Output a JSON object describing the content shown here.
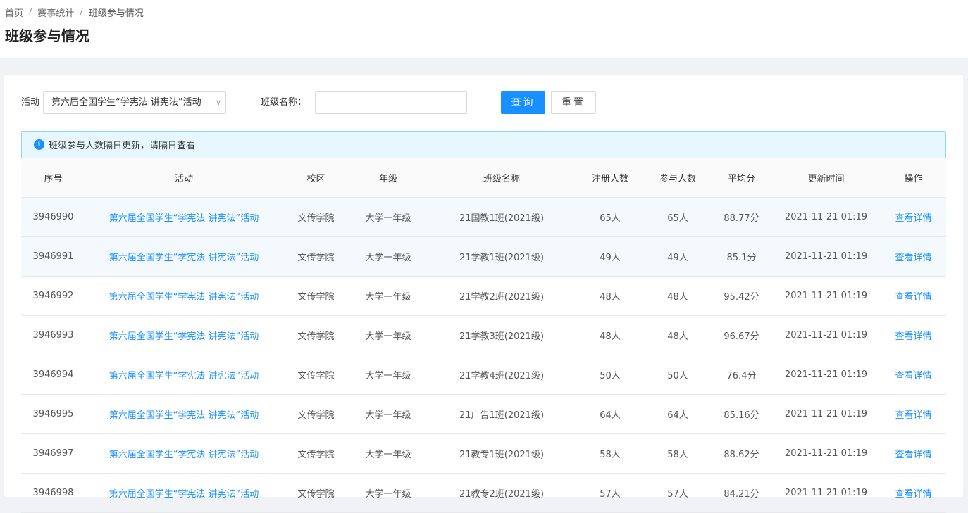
{
  "breadcrumb": [
    "首页",
    "赛事统计",
    "班级参与情况"
  ],
  "page_title": "班级参与情况",
  "filters": {
    "activity_label": "活动",
    "activity_value": "第六届全国学生“学宪法 讲宪法”活动",
    "class_name_label": "班级名称：",
    "class_name_value": "",
    "query_button": "查询",
    "reset_button": "重置"
  },
  "notice": "班级参与人数隔日更新，请隔日查看",
  "table": {
    "columns": [
      "序号",
      "活动",
      "校区",
      "年级",
      "班级名称",
      "注册人数",
      "参与人数",
      "平均分",
      "更新时间",
      "操作"
    ],
    "rows": [
      {
        "id": "3946990",
        "activity": "第六届全国学生“学宪法 讲宪法”活动",
        "campus": "文传学院",
        "grade": "大学一年级",
        "class_name": "21国教1班(2021级)",
        "registered": "65人",
        "participants": "65人",
        "avg": "88.77分",
        "updated": "2021-11-21 01:19",
        "action": "查看详情"
      },
      {
        "id": "3946991",
        "activity": "第六届全国学生“学宪法 讲宪法”活动",
        "campus": "文传学院",
        "grade": "大学一年级",
        "class_name": "21学教1班(2021级)",
        "registered": "49人",
        "participants": "49人",
        "avg": "85.1分",
        "updated": "2021-11-21 01:19",
        "action": "查看详情"
      },
      {
        "id": "3946992",
        "activity": "第六届全国学生“学宪法 讲宪法”活动",
        "campus": "文传学院",
        "grade": "大学一年级",
        "class_name": "21学教2班(2021级)",
        "registered": "48人",
        "participants": "48人",
        "avg": "95.42分",
        "updated": "2021-11-21 01:19",
        "action": "查看详情"
      },
      {
        "id": "3946993",
        "activity": "第六届全国学生“学宪法 讲宪法”活动",
        "campus": "文传学院",
        "grade": "大学一年级",
        "class_name": "21学教3班(2021级)",
        "registered": "48人",
        "participants": "48人",
        "avg": "96.67分",
        "updated": "2021-11-21 01:19",
        "action": "查看详情"
      },
      {
        "id": "3946994",
        "activity": "第六届全国学生“学宪法 讲宪法”活动",
        "campus": "文传学院",
        "grade": "大学一年级",
        "class_name": "21学教4班(2021级)",
        "registered": "50人",
        "participants": "50人",
        "avg": "76.4分",
        "updated": "2021-11-21 01:19",
        "action": "查看详情"
      },
      {
        "id": "3946995",
        "activity": "第六届全国学生“学宪法 讲宪法”活动",
        "campus": "文传学院",
        "grade": "大学一年级",
        "class_name": "21广告1班(2021级)",
        "registered": "64人",
        "participants": "64人",
        "avg": "85.16分",
        "updated": "2021-11-21 01:19",
        "action": "查看详情"
      },
      {
        "id": "3946997",
        "activity": "第六届全国学生“学宪法 讲宪法”活动",
        "campus": "文传学院",
        "grade": "大学一年级",
        "class_name": "21教专1班(2021级)",
        "registered": "58人",
        "participants": "58人",
        "avg": "88.62分",
        "updated": "2021-11-21 01:19",
        "action": "查看详情"
      },
      {
        "id": "3946998",
        "activity": "第六届全国学生“学宪法 讲宪法”活动",
        "campus": "文传学院",
        "grade": "大学一年级",
        "class_name": "21教专2班(2021级)",
        "registered": "57人",
        "participants": "57人",
        "avg": "84.21分",
        "updated": "2021-11-21 01:19",
        "action": "查看详情"
      }
    ]
  },
  "colors": {
    "primary": "#1890ff",
    "notice_bg": "#e6f7ff",
    "notice_border": "#91d5ff",
    "row_highlight": "#f3f9fd"
  },
  "icons": {
    "notice": "info-circle-icon",
    "select": "chevron-down-icon"
  }
}
